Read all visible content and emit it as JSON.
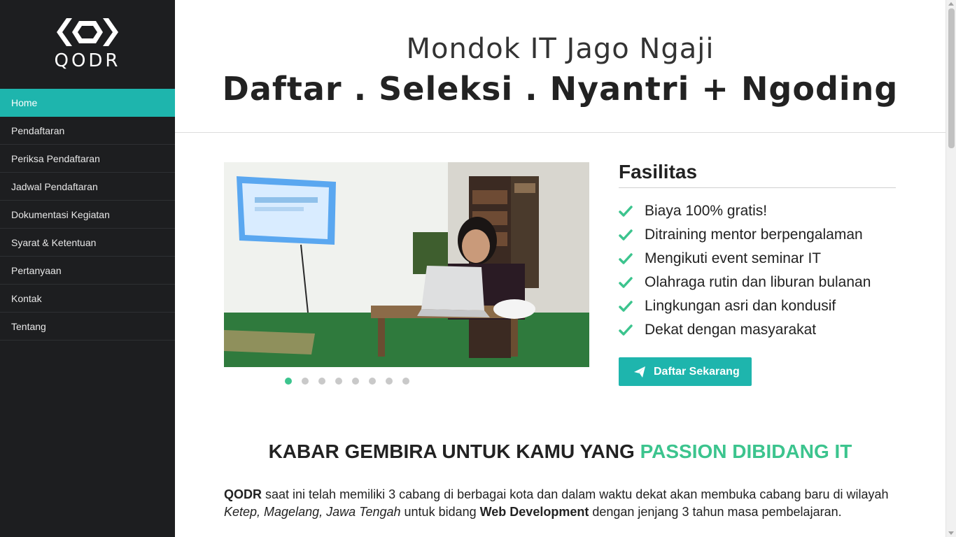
{
  "sidebar": {
    "logo_text": "QODR",
    "logo_icon": "hexagon-brackets-logo",
    "items": [
      {
        "label": "Home",
        "active": true
      },
      {
        "label": "Pendaftaran",
        "active": false
      },
      {
        "label": "Periksa Pendaftaran",
        "active": false
      },
      {
        "label": "Jadwal Pendaftaran",
        "active": false
      },
      {
        "label": "Dokumentasi Kegiatan",
        "active": false
      },
      {
        "label": "Syarat & Ketentuan",
        "active": false
      },
      {
        "label": "Pertanyaan",
        "active": false
      },
      {
        "label": "Kontak",
        "active": false
      },
      {
        "label": "Tentang",
        "active": false
      }
    ]
  },
  "hero": {
    "subtitle": "Mondok IT Jago Ngaji",
    "title": "Daftar . Seleksi . Nyantri + Ngoding"
  },
  "slider": {
    "slide_count": 8,
    "active_index": 0,
    "image_icon": "photo-student-laptop"
  },
  "facilities": {
    "title": "Fasilitas",
    "items": [
      "Biaya 100% gratis!",
      "Ditraining mentor berpengalaman",
      "Mengikuti event seminar IT",
      "Olahraga rutin dan liburan bulanan",
      "Lingkungan asri dan kondusif",
      "Dekat dengan masyarakat"
    ],
    "cta_label": "Daftar Sekarang",
    "cta_icon": "paper-plane-icon"
  },
  "kabar": {
    "prefix": "KABAR GEMBIRA UNTUK KAMU YANG ",
    "accent": "PASSION DIBIDANG IT"
  },
  "paragraph": {
    "brand": "QODR",
    "part1": " saat ini telah memiliki 3 cabang di berbagai kota dan dalam waktu dekat akan membuka cabang baru di wilayah ",
    "location": "Ketep, Magelang, Jawa Tengah",
    "part2": " untuk bidang ",
    "field": "Web Development",
    "part3": " dengan jenjang 3 tahun masa pembelajaran."
  },
  "colors": {
    "accent": "#1eb5ad",
    "green": "#3cc48e",
    "sidebar_bg": "#1d1e20"
  }
}
